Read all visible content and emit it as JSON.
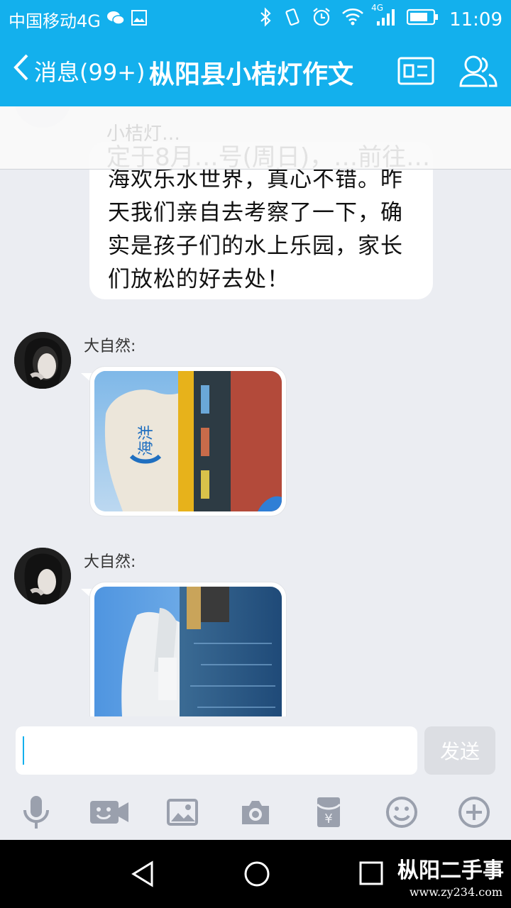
{
  "status": {
    "carrier": "中国移动4G",
    "network": "4G",
    "time": "11:09"
  },
  "header": {
    "back_label": "消息(99+)",
    "title": "枞阳县小桔灯作文"
  },
  "messages": {
    "banner_text_faint": "小桔灯…",
    "banner_text": "定于8月…号(周日)，…前往…",
    "text_bubble": "海欢乐水世界，真心不错。昨天我们亲自去考察了一下，确实是孩子们的水上乐园，家长们放松的好去处！",
    "msg1_sender": "大自然:",
    "msg2_sender": "大自然:",
    "photo1_sign": "海洋",
    "photo2_sign": ""
  },
  "composer": {
    "input_value": "",
    "send_label": "发送"
  },
  "toolbar_icons": [
    "microphone-icon",
    "video-icon",
    "image-icon",
    "camera-icon",
    "red-packet-icon",
    "emoji-icon",
    "plus-icon"
  ],
  "watermark": {
    "text": "枞阳二手事",
    "url": "www.zy234.com"
  }
}
